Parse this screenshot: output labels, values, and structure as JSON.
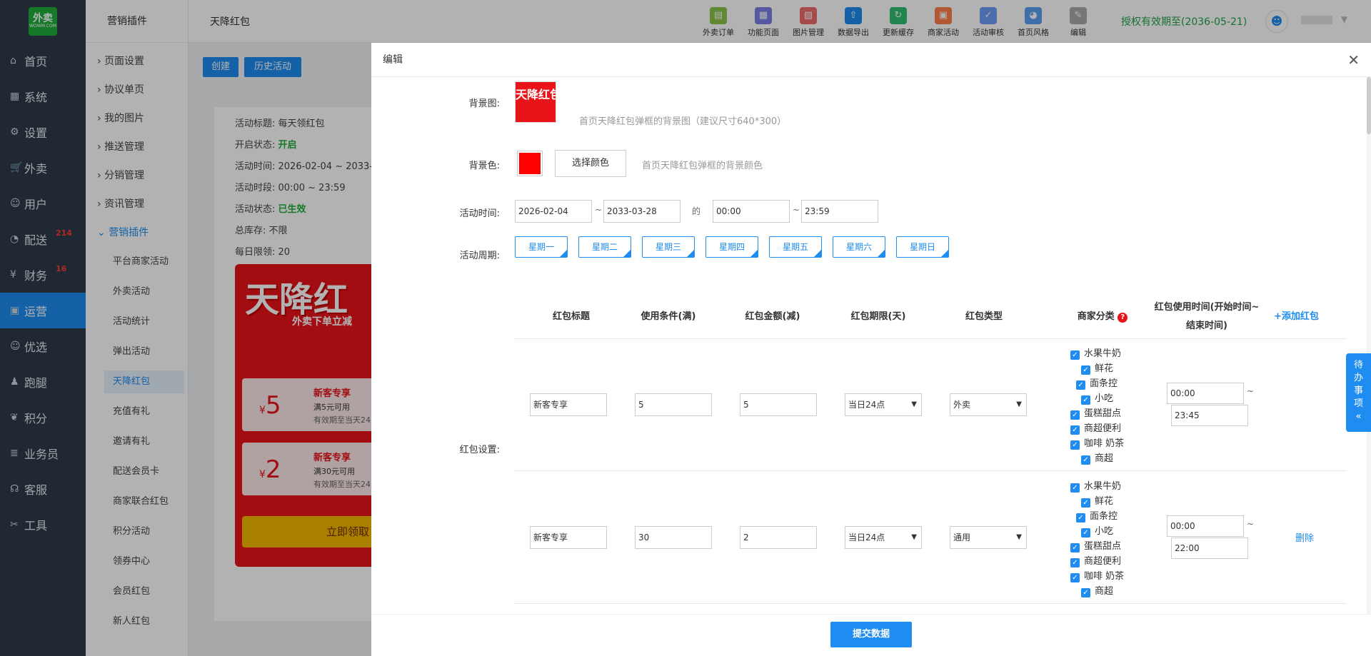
{
  "left_nav": {
    "logo_text": "外卖",
    "logo_sub": "WOWM.COM",
    "items": [
      {
        "label": "首页",
        "icon": "home-icon",
        "glyph": "⌂"
      },
      {
        "label": "系统",
        "icon": "windows-icon",
        "glyph": "▦"
      },
      {
        "label": "设置",
        "icon": "gear-icon",
        "glyph": "⚙"
      },
      {
        "label": "外卖",
        "icon": "cart-icon",
        "glyph": "🛒"
      },
      {
        "label": "用户",
        "icon": "user-icon",
        "glyph": "☺"
      },
      {
        "label": "配送",
        "icon": "speedometer-icon",
        "glyph": "◔",
        "badge": "214"
      },
      {
        "label": "财务",
        "icon": "yen-icon",
        "glyph": "¥",
        "badge": "16"
      },
      {
        "label": "运营",
        "icon": "gift-icon",
        "glyph": "▣"
      },
      {
        "label": "优选",
        "icon": "smile-icon",
        "glyph": "☺"
      },
      {
        "label": "跑腿",
        "icon": "person-icon",
        "glyph": "♟"
      },
      {
        "label": "积分",
        "icon": "bird-icon",
        "glyph": "❦"
      },
      {
        "label": "业务员",
        "icon": "layers-icon",
        "glyph": "≣"
      },
      {
        "label": "客服",
        "icon": "headset-icon",
        "glyph": "☊"
      },
      {
        "label": "工具",
        "icon": "tools-icon",
        "glyph": "✂"
      }
    ]
  },
  "sub_nav": {
    "header": "营销插件",
    "groups": [
      "页面设置",
      "协议单页",
      "我的图片",
      "推送管理",
      "分销管理",
      "资讯管理"
    ],
    "open_group": "营销插件",
    "subs": [
      "平台商家活动",
      "外卖活动",
      "活动统计",
      "弹出活动",
      "天降红包",
      "充值有礼",
      "邀请有礼",
      "配送会员卡",
      "商家联合红包",
      "积分活动",
      "领券中心",
      "会员红包",
      "新人红包"
    ]
  },
  "topbar": {
    "title": "天降红包",
    "tools": [
      {
        "label": "外卖订单",
        "icon": "order-icon",
        "color": "#8bc34a",
        "glyph": "▤"
      },
      {
        "label": "功能页面",
        "icon": "grid-icon",
        "color": "#7b7fe8",
        "glyph": "▦"
      },
      {
        "label": "图片管理",
        "icon": "image-icon",
        "color": "#f06a6a",
        "glyph": "▨"
      },
      {
        "label": "数据导出",
        "icon": "upload-icon",
        "color": "#1e8cf0",
        "glyph": "⇧"
      },
      {
        "label": "更新缓存",
        "icon": "refresh-icon",
        "color": "#2fbf71",
        "glyph": "↻"
      },
      {
        "label": "商家活动",
        "icon": "gift-icon",
        "color": "#ff7d4a",
        "glyph": "▣"
      },
      {
        "label": "活动审核",
        "icon": "audit-icon",
        "color": "#6e9cf5",
        "glyph": "✓"
      },
      {
        "label": "首页风格",
        "icon": "palette-icon",
        "color": "#5aa0f2",
        "glyph": "◕"
      },
      {
        "label": "编辑",
        "icon": "pencil-icon",
        "color": "#aaaaaa",
        "glyph": "✎"
      }
    ],
    "auth": "授权有效期至(2036-05-21)"
  },
  "page": {
    "create": "创建",
    "history": "历史活动",
    "info": [
      {
        "k": "活动标题: ",
        "v": "每天领红包"
      },
      {
        "k": "开启状态: ",
        "v": "开启"
      },
      {
        "k": "活动时间: ",
        "v": "2026-02-04 ~ 2033-"
      },
      {
        "k": "活动时段: ",
        "v": "00:00 ~ 23:59"
      },
      {
        "k": "活动状态: ",
        "v": "已生效"
      },
      {
        "k": "总库存: ",
        "v": "不限"
      },
      {
        "k": "每日限领: ",
        "v": "20"
      }
    ],
    "banner_title": "天降红",
    "banner_sub": "外卖下单立减",
    "coupons": [
      {
        "amount": "5",
        "title": "新客专享",
        "cond": "满5元可用",
        "exp": "有效期至当天24"
      },
      {
        "amount": "2",
        "title": "新客专享",
        "cond": "满30元可用",
        "exp": "有效期至当天24"
      }
    ],
    "get_btn": "立即领取"
  },
  "panel": {
    "title": "编辑",
    "bg_image_label": "背景图:",
    "bg_image_thumb": "天降红包",
    "bg_image_hint": "首页天降红包弹框的背景图（建议尺寸640*300）",
    "bg_color_label": "背景色:",
    "bg_color": "#ff0000",
    "choose_color": "选择颜色",
    "bg_color_hint": "首页天降红包弹框的背景颜色",
    "time_label": "活动时间:",
    "date_start": "2026-02-04",
    "date_end": "2033-03-28",
    "tilde": "~",
    "de": "的",
    "time_start": "00:00",
    "time_end": "23:59",
    "cycle_label": "活动周期:",
    "days": [
      "星期一",
      "星期二",
      "星期三",
      "星期四",
      "星期五",
      "星期六",
      "星期日"
    ],
    "redpack_label": "红包设置:",
    "headers": [
      "红包标题",
      "使用条件(满)",
      "红包金额(减)",
      "红包期限(天)",
      "红包类型",
      "商家分类",
      "红包使用时间(开始时间~结束时间)"
    ],
    "add": "+添加红包",
    "rows": [
      {
        "title": "新客专享",
        "cond": "5",
        "amount": "5",
        "limit": "当日24点",
        "type": "外卖",
        "start": "00:00",
        "end": "23:45",
        "del": ""
      },
      {
        "title": "新客专享",
        "cond": "30",
        "amount": "2",
        "limit": "当日24点",
        "type": "通用",
        "start": "00:00",
        "end": "22:00",
        "del": "删除"
      }
    ],
    "cats": [
      "水果牛奶",
      "鲜花",
      "面条控",
      "小吃",
      "蛋糕甜点",
      "商超便利",
      "咖啡 奶茶",
      "商超"
    ],
    "submit": "提交数据"
  },
  "todo": "待办事项"
}
